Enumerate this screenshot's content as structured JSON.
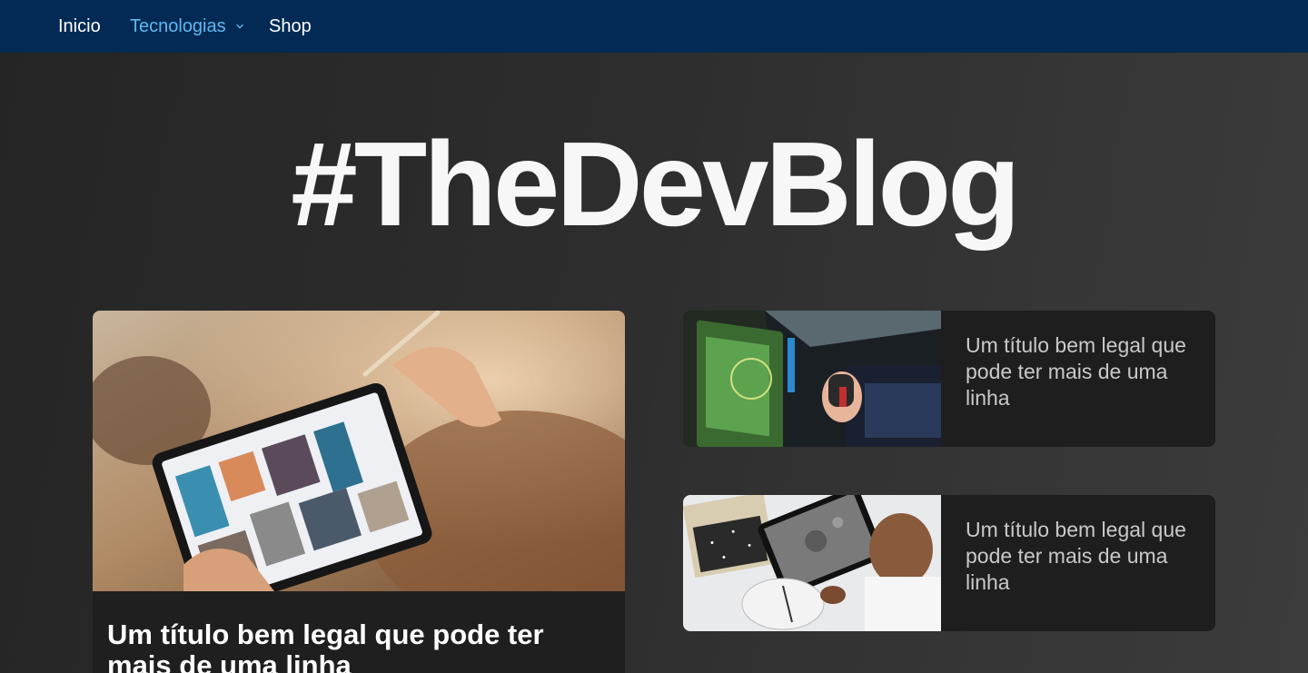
{
  "nav": {
    "items": [
      {
        "label": "Inicio",
        "active": false
      },
      {
        "label": "Tecnologias",
        "active": true,
        "dropdown": true
      },
      {
        "label": "Shop",
        "active": false
      }
    ],
    "background": "#022a55",
    "active_color": "#5fb8f0"
  },
  "hero": {
    "title": "#TheDevBlog"
  },
  "posts": {
    "featured": {
      "title": "Um título bem legal que pode ter mais de uma linha",
      "image_icon": "tablet-photo-image"
    },
    "side": [
      {
        "title": "Um título bem legal que pode ter mais de uma linha",
        "image_icon": "cockpit-joystick-image"
      },
      {
        "title": "Um título bem legal que pode ter mais de uma linha",
        "image_icon": "stars-map-tablet-image"
      }
    ]
  }
}
